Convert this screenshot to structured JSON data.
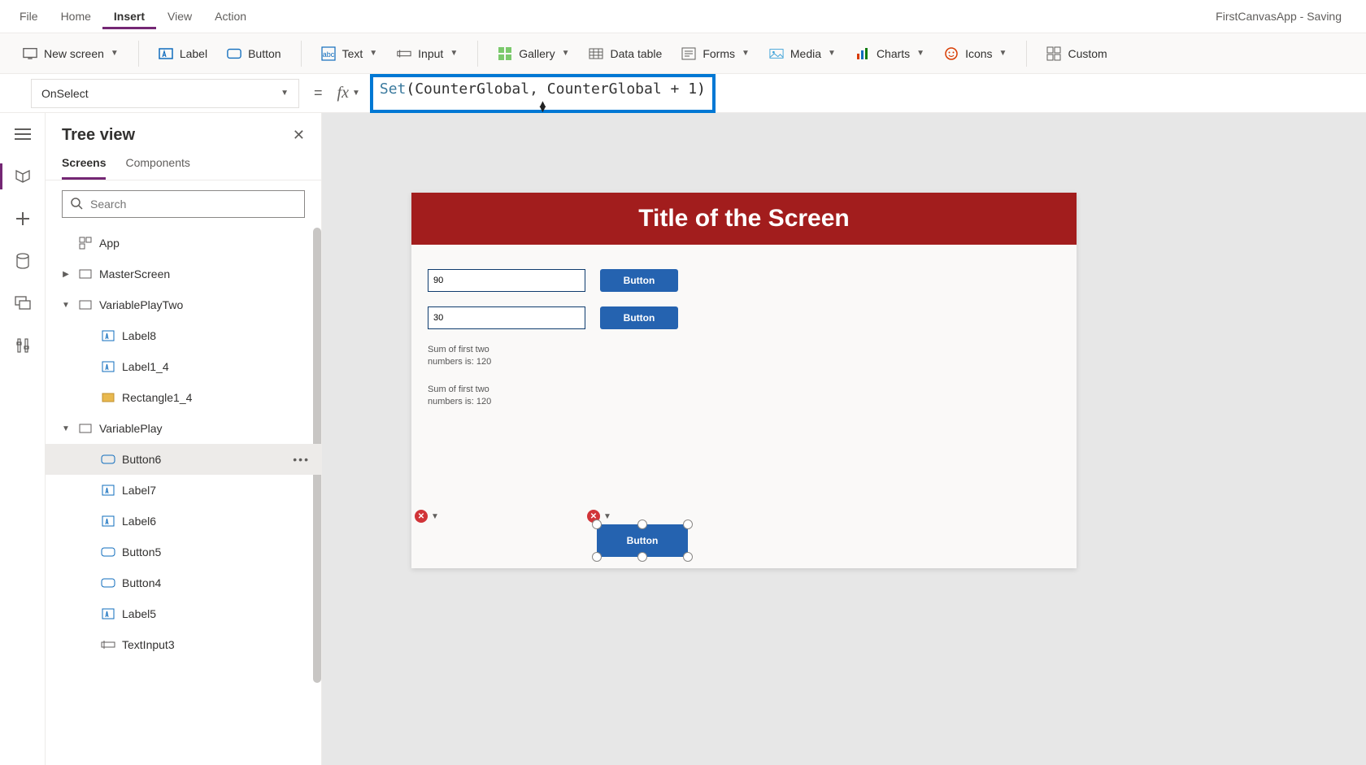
{
  "app_title": "FirstCanvasApp - Saving",
  "menus": [
    "File",
    "Home",
    "Insert",
    "View",
    "Action"
  ],
  "active_menu": "Insert",
  "ribbon": {
    "new_screen": "New screen",
    "label": "Label",
    "button": "Button",
    "text": "Text",
    "input": "Input",
    "gallery": "Gallery",
    "data_table": "Data table",
    "forms": "Forms",
    "media": "Media",
    "charts": "Charts",
    "icons": "Icons",
    "custom": "Custom"
  },
  "formula": {
    "property": "OnSelect",
    "tokens": {
      "func": "Set",
      "open": "(",
      "arg1": "CounterGlobal",
      "comma": ", ",
      "arg2": "CounterGlobal",
      "op": " + ",
      "num": "1",
      "close": ")"
    }
  },
  "tree": {
    "title": "Tree view",
    "tabs": [
      "Screens",
      "Components"
    ],
    "active_tab": "Screens",
    "search_placeholder": "Search",
    "items": [
      {
        "name": "App",
        "icon": "app",
        "indent": 1
      },
      {
        "name": "MasterScreen",
        "icon": "screen",
        "indent": 1,
        "expand": "right"
      },
      {
        "name": "VariablePlayTwo",
        "icon": "screen",
        "indent": 1,
        "expand": "down"
      },
      {
        "name": "Label8",
        "icon": "label",
        "indent": 3
      },
      {
        "name": "Label1_4",
        "icon": "label",
        "indent": 3
      },
      {
        "name": "Rectangle1_4",
        "icon": "rect",
        "indent": 3
      },
      {
        "name": "VariablePlay",
        "icon": "screen",
        "indent": 1,
        "expand": "down"
      },
      {
        "name": "Button6",
        "icon": "button",
        "indent": 3,
        "selected": true
      },
      {
        "name": "Label7",
        "icon": "label",
        "indent": 3
      },
      {
        "name": "Label6",
        "icon": "label",
        "indent": 3
      },
      {
        "name": "Button5",
        "icon": "button",
        "indent": 3
      },
      {
        "name": "Button4",
        "icon": "button",
        "indent": 3
      },
      {
        "name": "Label5",
        "icon": "label",
        "indent": 3
      },
      {
        "name": "TextInput3",
        "icon": "textinput",
        "indent": 3
      }
    ]
  },
  "canvas": {
    "title": "Title of the Screen",
    "input1": "90",
    "input2": "30",
    "button_label": "Button",
    "sum1": "Sum of first two numbers is: 120",
    "sum2": "Sum of first two numbers is: 120",
    "selected_button": "Button"
  }
}
